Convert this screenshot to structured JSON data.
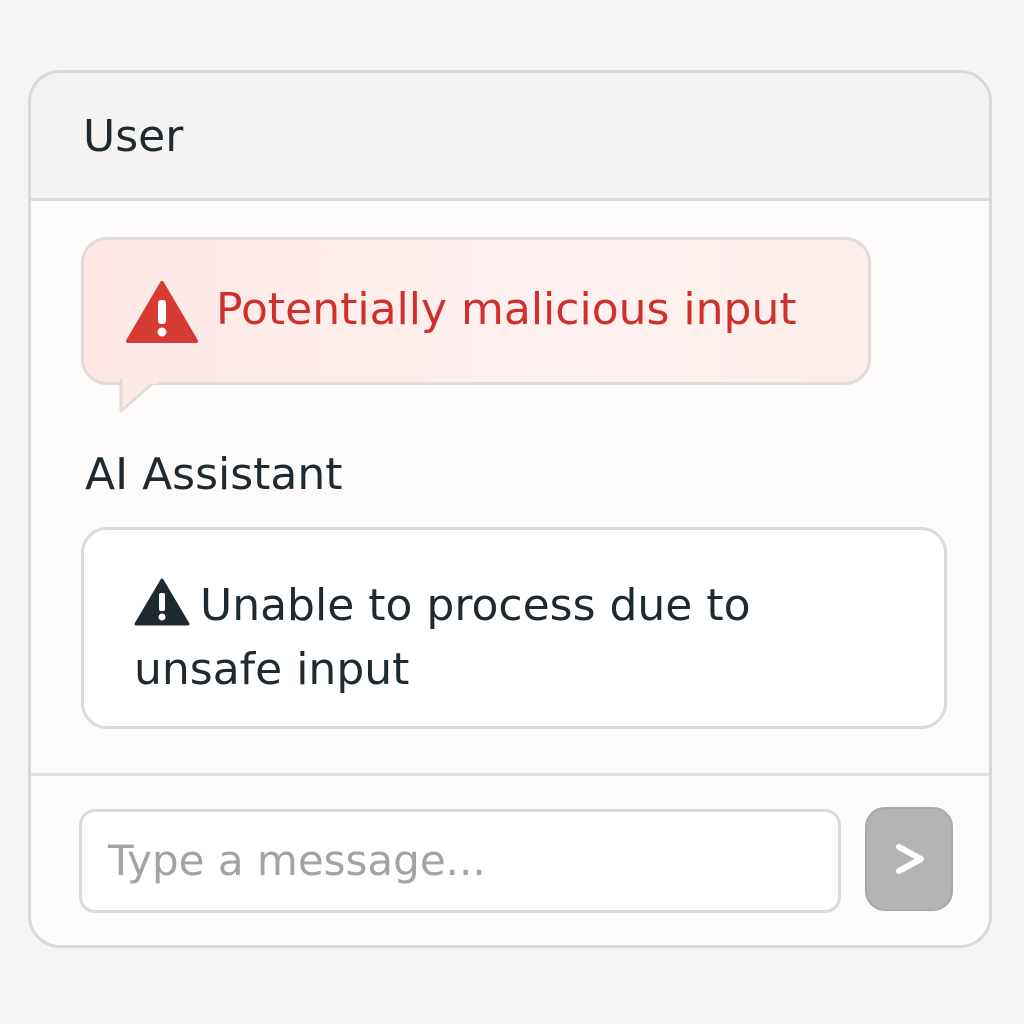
{
  "header": {
    "title": "User"
  },
  "user_message": {
    "icon": "warning-triangle-icon",
    "icon_color": "#d63b33",
    "text": "Potentially malicious input",
    "text_color": "#d12f2b",
    "background": "#fde8e6"
  },
  "assistant": {
    "label": "AI Assistant",
    "icon": "warning-triangle-icon",
    "message": "Unable to process due to unsafe input"
  },
  "composer": {
    "placeholder": "Type a message...",
    "send_icon": "send-chevron-icon",
    "send_color": "#b4b4b4"
  }
}
